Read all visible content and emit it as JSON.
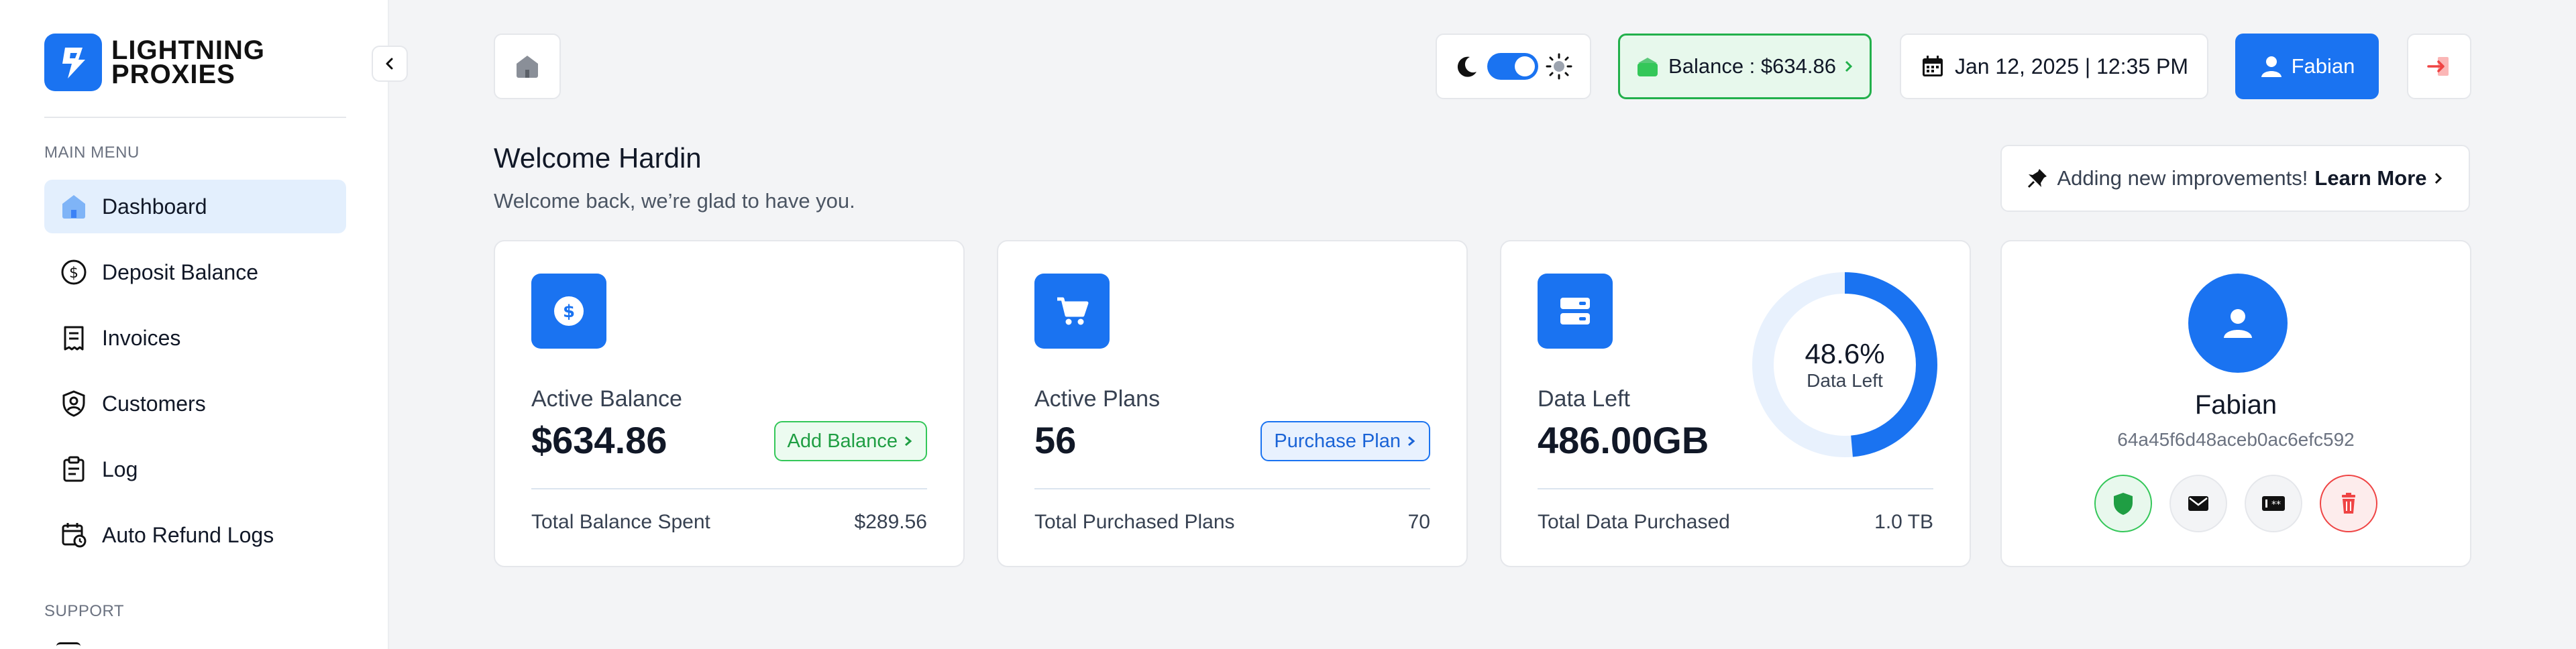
{
  "brand": {
    "line1": "LIGHTNING",
    "line2": "PROXIES"
  },
  "sidebar": {
    "main_menu_label": "MAIN MENU",
    "support_label": "SUPPORT",
    "items": [
      {
        "label": "Dashboard",
        "icon": "home-icon",
        "active": true
      },
      {
        "label": "Deposit Balance",
        "icon": "dollar-circle-icon"
      },
      {
        "label": "Invoices",
        "icon": "receipt-icon"
      },
      {
        "label": "Customers",
        "icon": "user-shield-icon"
      },
      {
        "label": "Log",
        "icon": "clipboard-icon"
      },
      {
        "label": "Auto Refund Logs",
        "icon": "calendar-clock-icon"
      }
    ]
  },
  "topbar": {
    "balance_label": "Balance : $634.86",
    "datetime": "Jan 12, 2025 | 12:35 PM",
    "user_name": "Fabian",
    "theme_toggle_on": true
  },
  "welcome": {
    "title": "Welcome Hardin",
    "subtitle": "Welcome back, we’re glad to have you.",
    "announcement": "Adding new improvements!",
    "announcement_link": "Learn More"
  },
  "cards": {
    "balance": {
      "label": "Active Balance",
      "value": "$634.86",
      "action": "Add Balance",
      "foot_label": "Total Balance Spent",
      "foot_value": "$289.56"
    },
    "plans": {
      "label": "Active Plans",
      "value": "56",
      "action": "Purchase Plan",
      "foot_label": "Total Purchased Plans",
      "foot_value": "70"
    },
    "data": {
      "label": "Data Left",
      "value": "486.00GB",
      "percent_text": "48.6%",
      "percent": 48.6,
      "percent_label": "Data Left",
      "foot_label": "Total Data Purchased",
      "foot_value": "1.0 TB"
    },
    "profile": {
      "name": "Fabian",
      "id": "64a45f6d48aceb0ac6efc592"
    }
  },
  "colors": {
    "accent": "#1a73f1",
    "success": "#22b04b",
    "danger": "#ef4444"
  }
}
